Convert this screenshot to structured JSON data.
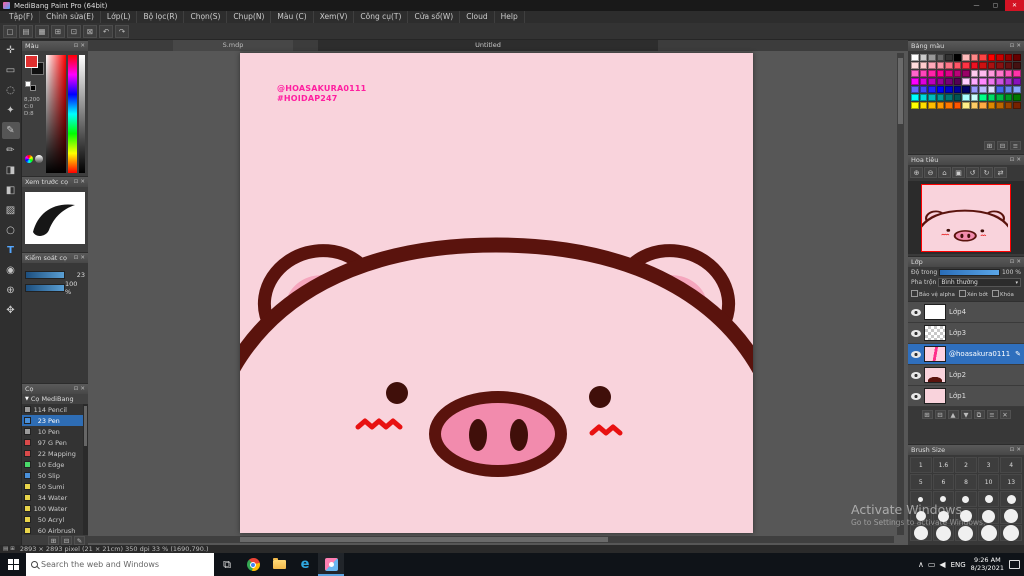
{
  "window": {
    "title": "MediBang Paint Pro (64bit)",
    "minimize": "—",
    "maximize": "▢",
    "close": "✕"
  },
  "menubar": {
    "items": [
      "Tập(F)",
      "Chỉnh sửa(E)",
      "Lớp(L)",
      "Bộ lọc(R)",
      "Chọn(S)",
      "Chụp(N)",
      "Màu (C)",
      "Xem(V)",
      "Công cụ(T)",
      "Cửa sổ(W)",
      "Cloud",
      "Help"
    ]
  },
  "toolbar": {
    "icons": [
      {
        "glyph": "▢",
        "data_name": "new-canvas-icon"
      },
      {
        "glyph": "▤",
        "data_name": "open-file-icon"
      },
      {
        "glyph": "▦",
        "data_name": "save-icon"
      },
      {
        "glyph": "⊞",
        "data_name": "grid-toggle-icon"
      },
      {
        "glyph": "⊡",
        "data_name": "snap-toggle-icon"
      },
      {
        "glyph": "⊠",
        "data_name": "ruler-toggle-icon"
      },
      {
        "glyph": "↶",
        "data_name": "undo-icon"
      },
      {
        "glyph": "↷",
        "data_name": "redo-icon"
      }
    ]
  },
  "tools": [
    {
      "glyph": "✛",
      "data_name": "move-tool"
    },
    {
      "glyph": "▭",
      "data_name": "select-tool"
    },
    {
      "glyph": "◌",
      "data_name": "lasso-tool"
    },
    {
      "glyph": "✦",
      "data_name": "magic-wand-tool"
    },
    {
      "glyph": "✎",
      "data_name": "pen-tool",
      "selected": true
    },
    {
      "glyph": "✏",
      "data_name": "pencil-tool"
    },
    {
      "glyph": "◨",
      "data_name": "eraser-tool"
    },
    {
      "glyph": "◧",
      "data_name": "bucket-tool"
    },
    {
      "glyph": "▨",
      "data_name": "gradient-tool"
    },
    {
      "glyph": "○",
      "data_name": "shape-tool"
    },
    {
      "glyph": "T",
      "data_name": "text-tool",
      "cls": "accent"
    },
    {
      "glyph": "◉",
      "data_name": "eyedropper-tool"
    },
    {
      "glyph": "⊕",
      "data_name": "zoom-tool"
    },
    {
      "glyph": "✥",
      "data_name": "hand-tool"
    }
  ],
  "ui": {
    "panel_icons": [
      "⊡",
      "✕"
    ]
  },
  "color_panel": {
    "title": "Màu",
    "values": [
      "8,200",
      "C:0",
      "D:8"
    ]
  },
  "brush_preview": {
    "title": "Xem trước cọ"
  },
  "brush_control": {
    "title": "Kiểm soát cọ",
    "rows": [
      {
        "value": "23"
      },
      {
        "value": "100 %"
      }
    ]
  },
  "brushes": {
    "title": "Cọ",
    "group_arrow": "▼",
    "group": "Cọ MediBang",
    "items": [
      {
        "num": "114",
        "name": "Pencil",
        "chip": "#9a9a9a"
      },
      {
        "num": "23",
        "name": "Pen",
        "chip": "#4a90d9",
        "selected": true
      },
      {
        "num": "10",
        "name": "Pen",
        "chip": "#9a9a9a"
      },
      {
        "num": "97",
        "name": "G Pen",
        "chip": "#d94a4a"
      },
      {
        "num": "22",
        "name": "Mapping",
        "chip": "#d94a4a"
      },
      {
        "num": "10",
        "name": "Edge",
        "chip": "#4ad96a"
      },
      {
        "num": "50",
        "name": "Slip",
        "chip": "#4a90d9"
      },
      {
        "num": "50",
        "name": "Sumi",
        "chip": "#e8d44a"
      },
      {
        "num": "34",
        "name": "Water",
        "chip": "#e8d44a"
      },
      {
        "num": "100",
        "name": "Water",
        "chip": "#e8d44a"
      },
      {
        "num": "50",
        "name": "Acryl",
        "chip": "#e8d44a"
      },
      {
        "num": "60",
        "name": "Airbrush",
        "chip": "#e8d44a"
      }
    ],
    "footer_icons": [
      {
        "glyph": "⊞",
        "data_name": "add-brush-icon"
      },
      {
        "glyph": "⊟",
        "data_name": "remove-brush-icon"
      },
      {
        "glyph": "✎",
        "data_name": "edit-brush-icon"
      }
    ]
  },
  "canvas": {
    "tab_file": "S.mdp",
    "tab_untitled": "Untitled",
    "mark_line1": "@HOASAKURA0111",
    "mark_line2": "#HOIDAP247"
  },
  "art": {
    "art-bg": "#f9d3dc",
    "art-line": "#5a130d",
    "art-ear": "#f5a6bd",
    "art-snout": "#f28bad",
    "art-eye": "#400f0a",
    "art-blush": "#e81111",
    "art-mark": "#ff1fa0"
  },
  "palette": {
    "title": "Bảng màu",
    "colors": [
      "#fff",
      "#ccc",
      "#999",
      "#666",
      "#333",
      "#000",
      "#fbb",
      "#f88",
      "#f44",
      "#f00",
      "#c00",
      "#900",
      "#600",
      "#fdd",
      "#fcc",
      "#fab",
      "#f9a",
      "#f78",
      "#f56",
      "#f34",
      "#e12",
      "#c11",
      "#a11",
      "#811",
      "#611",
      "#411",
      "#f6c",
      "#f4b",
      "#f2a",
      "#f09",
      "#d08",
      "#b07",
      "#906",
      "#fce",
      "#fbe",
      "#f9d",
      "#f7c",
      "#f5b",
      "#f3a",
      "#f0f",
      "#d0d",
      "#b0b",
      "#909",
      "#707",
      "#505",
      "#fcf",
      "#faf",
      "#f8f",
      "#e7e",
      "#c5d",
      "#a3c",
      "#81b",
      "#66f",
      "#44f",
      "#22f",
      "#00f",
      "#00c",
      "#009",
      "#006",
      "#99f",
      "#bbf",
      "#ddf",
      "#46e",
      "#68e",
      "#8af",
      "#0ff",
      "#0dd",
      "#0bb",
      "#099",
      "#077",
      "#055",
      "#aff",
      "#cff",
      "#0f8",
      "#0d6",
      "#0b4",
      "#092",
      "#070",
      "#ff0",
      "#fd0",
      "#fb0",
      "#f90",
      "#f70",
      "#f50",
      "#fe8",
      "#fc6",
      "#fa4",
      "#d80",
      "#b60",
      "#940",
      "#720"
    ],
    "footer_icons": [
      {
        "glyph": "⊞",
        "data_name": "add-color-icon"
      },
      {
        "glyph": "⊟",
        "data_name": "remove-color-icon"
      },
      {
        "glyph": "≡",
        "data_name": "palette-menu-icon"
      }
    ]
  },
  "navigator": {
    "title": "Hoa tiêu",
    "toolbar": [
      {
        "glyph": "⊕",
        "data_name": "zoom-in-icon"
      },
      {
        "glyph": "⊖",
        "data_name": "zoom-out-icon"
      },
      {
        "glyph": "⌂",
        "data_name": "fit-view-icon"
      },
      {
        "glyph": "▣",
        "data_name": "actual-size-icon"
      },
      {
        "glyph": "↺",
        "data_name": "rotate-left-icon"
      },
      {
        "glyph": "↻",
        "data_name": "rotate-right-icon"
      },
      {
        "glyph": "⇄",
        "data_name": "flip-icon"
      }
    ]
  },
  "layers": {
    "title": "Lớp",
    "opacity_label": "Độ trong",
    "opacity_value": "100 %",
    "blend_label": "Pha trộn",
    "blend_value": "Bình thường",
    "blend_caret": "▾",
    "checkboxes": [
      "Bảo vệ alpha",
      "Xén bớt",
      "Khóa"
    ],
    "items": [
      {
        "name": "Lớp4",
        "thumb": "#ffffff"
      },
      {
        "name": "Lớp3",
        "thumb": "repeating-conic-gradient(#c8c8c8 0% 25%, #ffffff 0% 50%) 0 0 / 6px 6px"
      },
      {
        "name": "@hoasakura0111",
        "thumb": "linear-gradient(100deg,#ffd3e2 45%,#ff2d8a 45% 58%,#ffd3e2 58%)",
        "selected": true,
        "edit_icon": "✎"
      },
      {
        "name": "Lớp2",
        "thumb": "radial-gradient(60% 48% at 50% 92%, #5a130d 58%, #f9d3dc 60%)"
      },
      {
        "name": "Lớp1",
        "thumb": "#f9d3dc"
      }
    ],
    "footer_icons": [
      {
        "glyph": "⊞",
        "data_name": "add-layer-icon"
      },
      {
        "glyph": "⊟",
        "data_name": "delete-layer-icon"
      },
      {
        "glyph": "▲",
        "data_name": "move-layer-up-icon"
      },
      {
        "glyph": "▼",
        "data_name": "move-layer-down-icon"
      },
      {
        "glyph": "⧉",
        "data_name": "duplicate-layer-icon"
      },
      {
        "glyph": "≡",
        "data_name": "merge-layer-icon"
      },
      {
        "glyph": "✕",
        "data_name": "clear-layer-icon"
      }
    ]
  },
  "brush_size": {
    "title": "Brush Size",
    "cells": [
      {
        "t": "1"
      },
      {
        "t": "1.6"
      },
      {
        "t": "2"
      },
      {
        "t": "3"
      },
      {
        "t": "4"
      },
      {
        "t": "5"
      },
      {
        "t": "6"
      },
      {
        "t": "8"
      },
      {
        "t": "10"
      },
      {
        "t": "13"
      },
      {
        "d": "5px"
      },
      {
        "d": "6px"
      },
      {
        "d": "7px"
      },
      {
        "d": "8px"
      },
      {
        "d": "9px"
      },
      {
        "d": "10px"
      },
      {
        "d": "11px"
      },
      {
        "d": "12px"
      },
      {
        "d": "13px"
      },
      {
        "d": "14px"
      },
      {
        "d": "14px"
      },
      {
        "d": "15px"
      },
      {
        "d": "15px"
      },
      {
        "d": "16px"
      },
      {
        "d": "16px"
      }
    ]
  },
  "statusbar": {
    "icons": [
      "▤",
      "⊞"
    ],
    "text": "2893 × 2893 pixel   (21 × 21cm)   350 dpi   33 %   (1690,790.)"
  },
  "activate": {
    "line1": "Activate Windows",
    "line2": "Go to Settings to activate Windows."
  },
  "taskbar": {
    "search_placeholder": "Search the web and Windows",
    "taskview_glyph": "⧉",
    "edge_glyph": "e",
    "tray": [
      {
        "glyph": "∧",
        "data_name": "tray-expand-icon"
      },
      {
        "glyph": "▭",
        "data_name": "display-icon"
      },
      {
        "glyph": "◀",
        "data_name": "volume-icon"
      }
    ],
    "lang": "ENG",
    "time": "9:26 AM",
    "date": "8/23/2021"
  }
}
